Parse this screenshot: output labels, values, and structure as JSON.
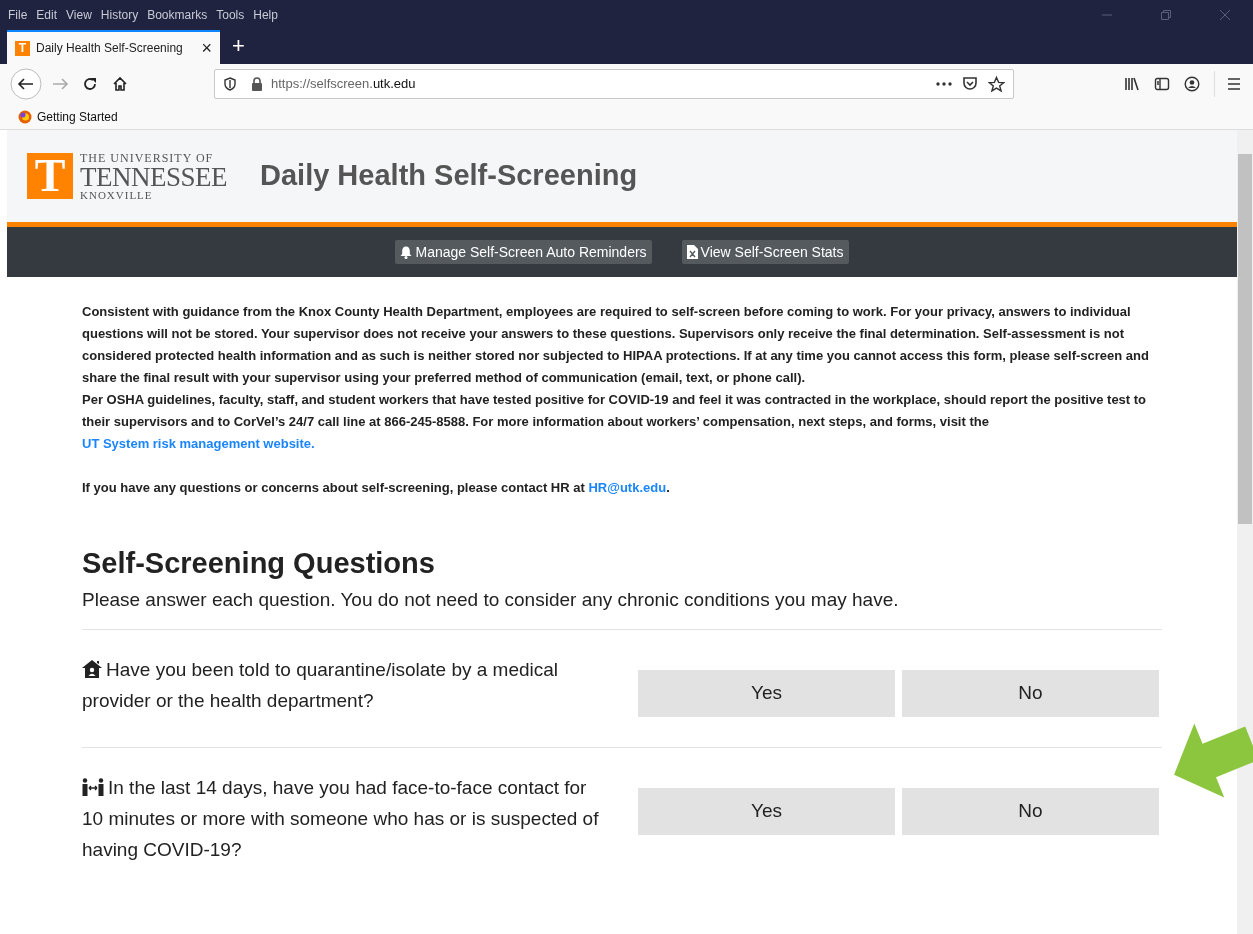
{
  "browser": {
    "menu": [
      "File",
      "Edit",
      "View",
      "History",
      "Bookmarks",
      "Tools",
      "Help"
    ],
    "tab": {
      "favicon": "T",
      "title": "Daily Health Self-Screening",
      "close": "×",
      "selected": true
    },
    "new_tab": "+",
    "url": {
      "host_prefix": "https://selfscreen.",
      "domain": "utk.edu"
    },
    "bookmarks": [
      "Getting Started"
    ]
  },
  "header": {
    "logo": {
      "mark": "T",
      "line1": "THE UNIVERSITY OF",
      "line2": "TENNESSEE",
      "line3": "KNOXVILLE"
    },
    "title": "Daily Health Self-Screening"
  },
  "nav": [
    {
      "kind": "bell",
      "label": "Manage Self-Screen Auto Reminders"
    },
    {
      "kind": "file",
      "label": "View Self-Screen Stats"
    }
  ],
  "intro": [
    {
      "text": "Consistent with guidance from the Knox County Health Department, employees are required to self-screen before coming to work. For your privacy, answers to individual questions will not be stored. Your supervisor does not receive your answers to these questions. Supervisors only receive the final determination. Self-assessment is not considered protected health information and as such is neither stored nor subjected to HIPAA protections. If at any time you cannot access this form, please self-screen and share the final result with your supervisor using your preferred method of communication (email, text, or phone call)."
    },
    {
      "text": "Per OSHA guidelines, faculty, staff, and student workers that have tested positive for COVID-19 and feel it was contracted in the workplace, should report the positive test to their supervisors and to CorVel’s 24/7 call line at 866-245-8588. For more information about workers’ compensation, next steps, and forms, visit the",
      "link": "UT System risk management website."
    },
    {
      "text": "If you have any questions or concerns about self-screening, please contact HR at",
      "link": "HR@utk.edu",
      "after": "."
    }
  ],
  "questions_section": {
    "title": "Self-Screening Questions",
    "subtitle": "Please answer each question. You do not need to consider any chronic conditions you may have.",
    "questions": [
      {
        "kind": "house",
        "text": "Have you been told to quarantine/isolate by a medical provider or the health department?",
        "answers": [
          {
            "label": "Yes",
            "selected": false
          },
          {
            "label": "No",
            "selected": false
          }
        ]
      },
      {
        "kind": "distance",
        "text": "In the last 14 days, have you had face-to-face contact for 10 minutes or more with someone who has or is suspected of having COVID-19?",
        "answers": [
          {
            "label": "Yes",
            "selected": false
          },
          {
            "label": "No",
            "selected": false
          }
        ]
      }
    ]
  }
}
